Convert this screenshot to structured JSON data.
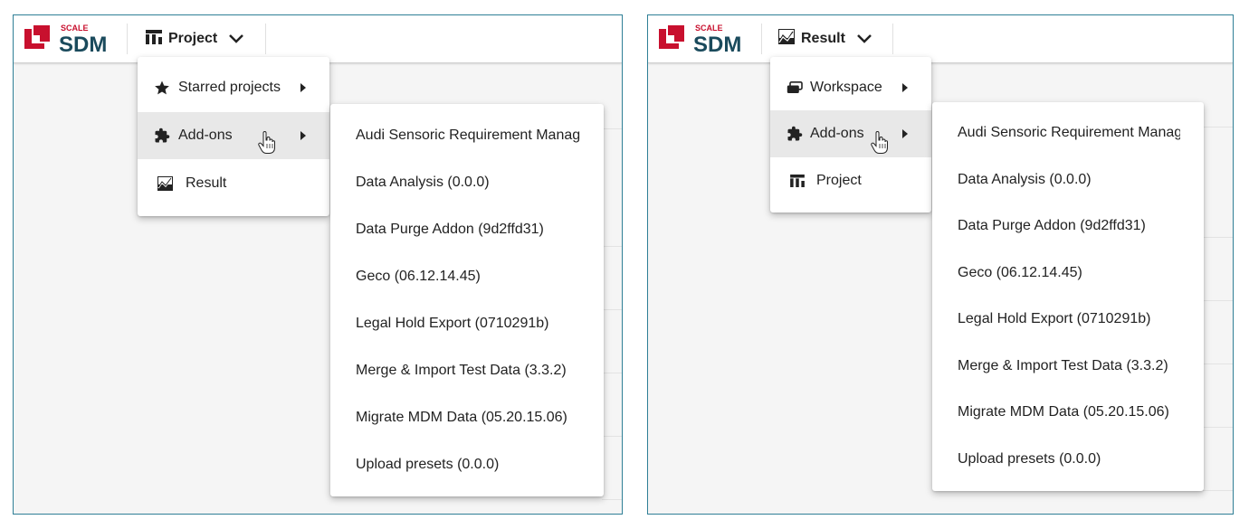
{
  "colors": {
    "brand_red": "#c8102e",
    "brand_teal": "#1a4a5c",
    "panel_border": "#2f7f96",
    "hover_bg": "#e8e8e8"
  },
  "left": {
    "logo": {
      "small": "SCALE",
      "big": "SDM"
    },
    "nav": {
      "label": "Project",
      "icon": "project-bars-icon"
    },
    "menu": [
      {
        "label": "Starred projects",
        "icon": "star-icon",
        "submenu": true
      },
      {
        "label": "Add-ons",
        "icon": "puzzle-icon",
        "submenu": true,
        "active": true
      },
      {
        "label": "Result",
        "icon": "result-chart-icon",
        "submenu": false
      }
    ],
    "addons": [
      "Audi Sensoric Requirement Manag…",
      "Data Analysis (0.0.0)",
      "Data Purge Addon (9d2ffd31)",
      "Geco (06.12.14.45)",
      "Legal Hold Export (0710291b)",
      "Merge & Import Test Data (3.3.2)",
      "Migrate MDM Data (05.20.15.06)",
      "Upload presets (0.0.0)"
    ]
  },
  "right": {
    "logo": {
      "small": "SCALE",
      "big": "SDM"
    },
    "nav": {
      "label": "Result",
      "icon": "result-chart-icon"
    },
    "menu": [
      {
        "label": "Workspace",
        "icon": "workspace-icon",
        "submenu": true
      },
      {
        "label": "Add-ons",
        "icon": "puzzle-icon",
        "submenu": true,
        "active": true
      },
      {
        "label": "Project",
        "icon": "project-bars-icon",
        "submenu": false
      }
    ],
    "addons": [
      "Audi Sensoric Requirement Manag…",
      "Data Analysis (0.0.0)",
      "Data Purge Addon (9d2ffd31)",
      "Geco (06.12.14.45)",
      "Legal Hold Export (0710291b)",
      "Merge & Import Test Data (3.3.2)",
      "Migrate MDM Data (05.20.15.06)",
      "Upload presets (0.0.0)"
    ]
  }
}
